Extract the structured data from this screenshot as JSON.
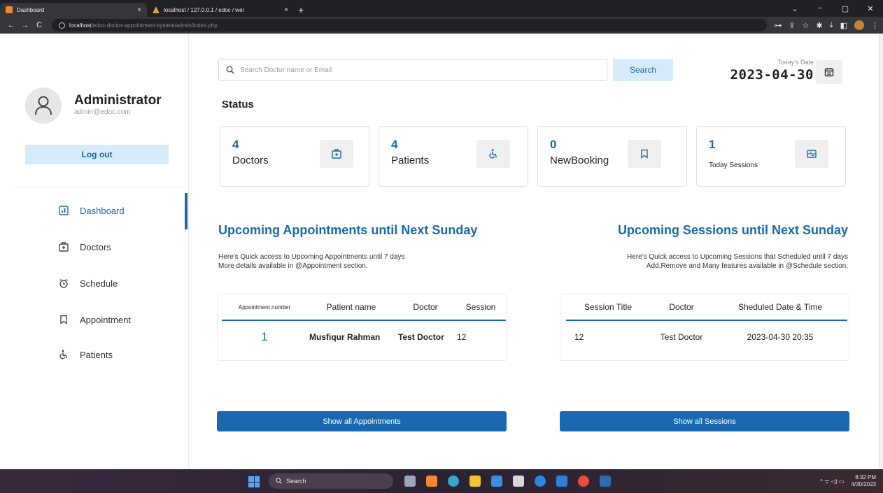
{
  "browser": {
    "tabs": [
      {
        "label": "Dashboard",
        "close": "×"
      },
      {
        "label": "localhost / 127.0.0.1 / edoc / wei",
        "close": "×"
      }
    ],
    "new_tab": "+",
    "window_controls": {
      "chevron": "⌄",
      "minimize": "−",
      "maximize": "▢",
      "close": "✕"
    },
    "nav": {
      "back": "←",
      "forward": "→",
      "reload": "C"
    },
    "url_host": "localhost",
    "url_path": "/edoc-doctor-appointment-system/admin/index.php",
    "addr_icons": {
      "key": "⊶",
      "share": "⇪",
      "star": "☆",
      "pin": "✱",
      "download": "⤓",
      "panel": "◧",
      "menu": "⋮"
    }
  },
  "sidebar": {
    "profile_name": "Administrator",
    "profile_email": "admin@edoc.com",
    "logout_label": "Log out",
    "menu": [
      {
        "label": "Dashboard",
        "icon": "dashboard-icon"
      },
      {
        "label": "Doctors",
        "icon": "doctor-icon"
      },
      {
        "label": "Schedule",
        "icon": "schedule-icon"
      },
      {
        "label": "Appointment",
        "icon": "bookmark-icon"
      },
      {
        "label": "Patients",
        "icon": "wheelchair-icon"
      }
    ]
  },
  "header": {
    "search_placeholder": "Search Doctor name or Email",
    "search_button": "Search",
    "date_label": "Today's Date",
    "date_value": "2023-04-30"
  },
  "status": {
    "title": "Status",
    "cards": [
      {
        "value": "4",
        "label": "Doctors",
        "icon": "doctor-icon"
      },
      {
        "value": "4",
        "label": "Patients",
        "icon": "wheelchair-icon"
      },
      {
        "value": "0",
        "label": "NewBooking",
        "icon": "bookmark-icon"
      },
      {
        "value": "1",
        "label": "Today Sessions",
        "icon": "sessions-icon"
      }
    ]
  },
  "appointments": {
    "title": "Upcoming Appointments until Next Sunday",
    "desc_line1": "Here's Quick access to Upcoming Appointments until 7 days",
    "desc_line2": "More details available in @Appointment section.",
    "headers": [
      "Appointment number",
      "Patient name",
      "Doctor",
      "Session"
    ],
    "rows": [
      [
        "1",
        "Musfiqur Rahman",
        "Test Doctor",
        "12"
      ]
    ],
    "button": "Show all Appointments"
  },
  "sessions": {
    "title": "Upcoming Sessions until Next Sunday",
    "desc_line1": "Here's Quick access to Upcoming Sessions that Scheduled until 7 days",
    "desc_line2": "Add,Remove and Many features available in @Schedule section.",
    "headers": [
      "Session Title",
      "Doctor",
      "Sheduled Date & Time"
    ],
    "rows": [
      [
        "12",
        "Test Doctor",
        "2023-04-30 20:35"
      ]
    ],
    "button": "Show all Sessions"
  },
  "taskbar": {
    "search_label": "Search",
    "tray": "^  ᯤ  ◁)  ▭",
    "time": "8:32 PM",
    "date": "4/30/2023",
    "colors": {
      "start": "#4ea6ff",
      "accent": "#1a69b0"
    }
  }
}
